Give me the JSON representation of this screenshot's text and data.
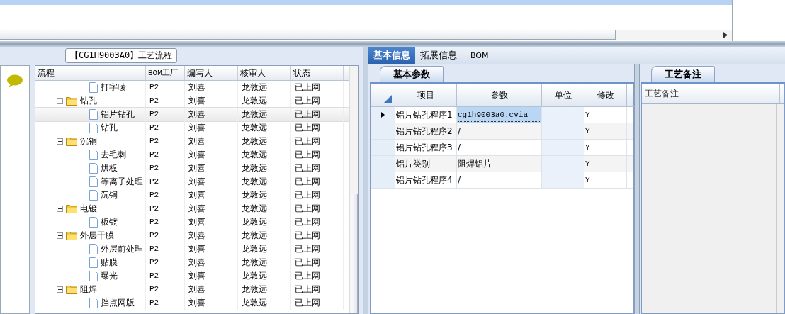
{
  "group_title": "【CG1H9003A0】工艺流程",
  "tree": {
    "columns": [
      "流程",
      "BOM工厂",
      "编写人",
      "核审人",
      "状态"
    ],
    "items": [
      {
        "children": [
          {
            "label": "打字唛",
            "bom": "P2",
            "writer": "刘喜",
            "reviewer": "龙敦远",
            "status": "已上网",
            "selected": false
          }
        ]
      },
      {
        "label": "钻孔",
        "bom": "P2",
        "writer": "刘喜",
        "reviewer": "龙敦远",
        "status": "已上网",
        "selected": false,
        "expanded": true,
        "children": [
          {
            "label": "铝片钻孔",
            "bom": "P2",
            "writer": "刘喜",
            "reviewer": "龙敦远",
            "status": "已上网",
            "selected": true
          },
          {
            "label": "钻孔",
            "bom": "P2",
            "writer": "刘喜",
            "reviewer": "龙敦远",
            "status": "已上网",
            "selected": false
          }
        ]
      },
      {
        "label": "沉铜",
        "bom": "P2",
        "writer": "刘喜",
        "reviewer": "龙敦远",
        "status": "已上网",
        "selected": false,
        "expanded": true,
        "children": [
          {
            "label": "去毛刺",
            "bom": "P2",
            "writer": "刘喜",
            "reviewer": "龙敦远",
            "status": "已上网",
            "selected": false
          },
          {
            "label": "烘板",
            "bom": "P2",
            "writer": "刘喜",
            "reviewer": "龙敦远",
            "status": "已上网",
            "selected": false
          },
          {
            "label": "等离子处理",
            "bom": "P2",
            "writer": "刘喜",
            "reviewer": "龙敦远",
            "status": "已上网",
            "selected": false
          },
          {
            "label": "沉铜",
            "bom": "P2",
            "writer": "刘喜",
            "reviewer": "龙敦远",
            "status": "已上网",
            "selected": false
          }
        ]
      },
      {
        "label": "电镀",
        "bom": "P2",
        "writer": "刘喜",
        "reviewer": "龙敦远",
        "status": "已上网",
        "selected": false,
        "expanded": true,
        "children": [
          {
            "label": "板镀",
            "bom": "P2",
            "writer": "刘喜",
            "reviewer": "龙敦远",
            "status": "已上网",
            "selected": false
          }
        ]
      },
      {
        "label": "外层干膜",
        "bom": "P2",
        "writer": "刘喜",
        "reviewer": "龙敦远",
        "status": "已上网",
        "selected": false,
        "expanded": true,
        "children": [
          {
            "label": "外层前处理",
            "bom": "P2",
            "writer": "刘喜",
            "reviewer": "龙敦远",
            "status": "已上网",
            "selected": false
          },
          {
            "label": "贴膜",
            "bom": "P2",
            "writer": "刘喜",
            "reviewer": "龙敦远",
            "status": "已上网",
            "selected": false
          },
          {
            "label": "曝光",
            "bom": "P2",
            "writer": "刘喜",
            "reviewer": "龙敦远",
            "status": "已上网",
            "selected": false
          }
        ]
      },
      {
        "label": "阻焊",
        "bom": "P2",
        "writer": "刘喜",
        "reviewer": "龙敦远",
        "status": "已上网",
        "selected": false,
        "expanded": true,
        "children": [
          {
            "label": "挡点网版",
            "bom": "P2",
            "writer": "刘喜",
            "reviewer": "龙敦远",
            "status": "已上网",
            "selected": false
          }
        ]
      }
    ]
  },
  "tabs": [
    {
      "label": "基本信息",
      "selected": true
    },
    {
      "label": "拓展信息",
      "selected": false
    },
    {
      "label": "BOM",
      "selected": false
    }
  ],
  "sub_tab": "基本参数",
  "params": {
    "columns": [
      "项目",
      "参数",
      "单位",
      "修改"
    ],
    "rows": [
      {
        "item": "铝片钻孔程序1",
        "param": "cg1h9003a0.cvia",
        "modify": "Y",
        "selected": true
      },
      {
        "item": "铝片钻孔程序2",
        "param": "/",
        "modify": "Y",
        "selected": false
      },
      {
        "item": "铝片钻孔程序3",
        "param": "/",
        "modify": "Y",
        "selected": false
      },
      {
        "item": "铝片类别",
        "param": "阻焊铝片",
        "modify": "Y",
        "selected": false
      },
      {
        "item": "铝片钻孔程序4",
        "param": "/",
        "modify": "Y",
        "selected": false
      }
    ]
  },
  "notes_tab": "工艺备注",
  "notes_column": "工艺备注"
}
